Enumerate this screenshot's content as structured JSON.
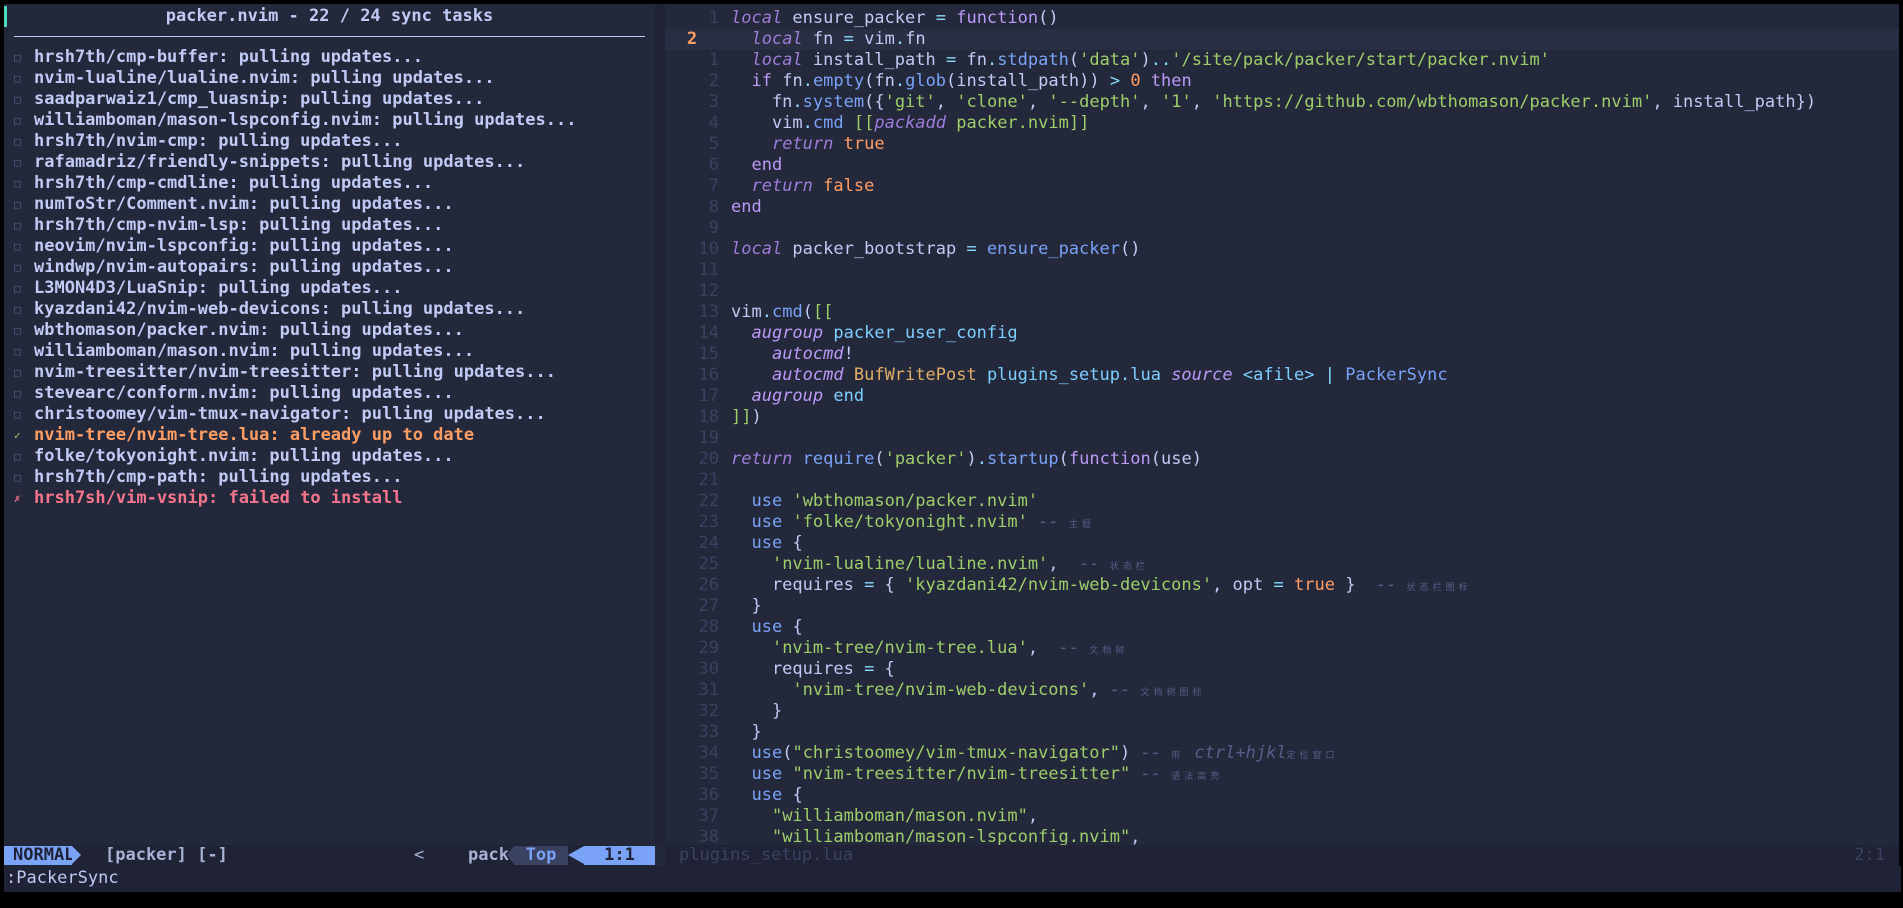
{
  "packer": {
    "title": "packer.nvim - 22 / 24 sync tasks",
    "items": [
      {
        "mark": "□",
        "text": "hrsh7th/cmp-buffer: pulling updates...",
        "state": "pending"
      },
      {
        "mark": "□",
        "text": "nvim-lualine/lualine.nvim: pulling updates...",
        "state": "pending"
      },
      {
        "mark": "□",
        "text": "saadparwaiz1/cmp_luasnip: pulling updates...",
        "state": "pending"
      },
      {
        "mark": "□",
        "text": "williamboman/mason-lspconfig.nvim: pulling updates...",
        "state": "pending"
      },
      {
        "mark": "□",
        "text": "hrsh7th/nvim-cmp: pulling updates...",
        "state": "pending"
      },
      {
        "mark": "□",
        "text": "rafamadriz/friendly-snippets: pulling updates...",
        "state": "pending"
      },
      {
        "mark": "□",
        "text": "hrsh7th/cmp-cmdline: pulling updates...",
        "state": "pending"
      },
      {
        "mark": "□",
        "text": "numToStr/Comment.nvim: pulling updates...",
        "state": "pending"
      },
      {
        "mark": "□",
        "text": "hrsh7th/cmp-nvim-lsp: pulling updates...",
        "state": "pending"
      },
      {
        "mark": "□",
        "text": "neovim/nvim-lspconfig: pulling updates...",
        "state": "pending"
      },
      {
        "mark": "□",
        "text": "windwp/nvim-autopairs: pulling updates...",
        "state": "pending"
      },
      {
        "mark": "□",
        "text": "L3MON4D3/LuaSnip: pulling updates...",
        "state": "pending"
      },
      {
        "mark": "□",
        "text": "kyazdani42/nvim-web-devicons: pulling updates...",
        "state": "pending"
      },
      {
        "mark": "□",
        "text": "wbthomason/packer.nvim: pulling updates...",
        "state": "pending"
      },
      {
        "mark": "□",
        "text": "williamboman/mason.nvim: pulling updates...",
        "state": "pending"
      },
      {
        "mark": "□",
        "text": "nvim-treesitter/nvim-treesitter: pulling updates...",
        "state": "pending"
      },
      {
        "mark": "□",
        "text": "stevearc/conform.nvim: pulling updates...",
        "state": "pending"
      },
      {
        "mark": "□",
        "text": "christoomey/vim-tmux-navigator: pulling updates...",
        "state": "pending"
      },
      {
        "mark": "✓",
        "text": "nvim-tree/nvim-tree.lua: already up to date",
        "state": "ok"
      },
      {
        "mark": "□",
        "text": "folke/tokyonight.nvim: pulling updates...",
        "state": "pending"
      },
      {
        "mark": "□",
        "text": "hrsh7th/cmp-path: pulling updates...",
        "state": "pending"
      },
      {
        "mark": "✗",
        "text": "hrsh7sh/vim-vsnip: failed to install",
        "state": "err"
      }
    ]
  },
  "editor": {
    "line_numbers": [
      "1",
      "2",
      "1",
      "2",
      "3",
      "4",
      "5",
      "6",
      "7",
      "8",
      "9",
      "10",
      "11",
      "12",
      "13",
      "14",
      "15",
      "16",
      "17",
      "18",
      "19",
      "20",
      "21",
      "22",
      "23",
      "24",
      "25",
      "26",
      "27",
      "28",
      "29",
      "30",
      "31",
      "32",
      "33",
      "34",
      "35",
      "36",
      "37",
      "38"
    ],
    "current_line_index": 1,
    "lines": [
      [
        [
          "k",
          "local"
        ],
        [
          "p",
          " ensure_packer "
        ],
        [
          "op",
          "="
        ],
        [
          "p",
          " "
        ],
        [
          "kw",
          "function"
        ],
        [
          "p",
          "()"
        ]
      ],
      [
        [
          "p",
          "  "
        ],
        [
          "k",
          "local"
        ],
        [
          "p",
          " fn "
        ],
        [
          "op",
          "="
        ],
        [
          "p",
          " vim"
        ],
        [
          "op",
          "."
        ],
        [
          "p",
          "fn"
        ]
      ],
      [
        [
          "p",
          "  "
        ],
        [
          "k",
          "local"
        ],
        [
          "p",
          " install_path "
        ],
        [
          "op",
          "="
        ],
        [
          "p",
          " fn"
        ],
        [
          "op",
          "."
        ],
        [
          "f",
          "stdpath"
        ],
        [
          "p",
          "("
        ],
        [
          "s",
          "'data'"
        ],
        [
          "p",
          ")"
        ],
        [
          "op",
          ".."
        ],
        [
          "s",
          "'/site/pack/packer/start/packer.nvim'"
        ]
      ],
      [
        [
          "p",
          "  "
        ],
        [
          "kw",
          "if"
        ],
        [
          "p",
          " fn"
        ],
        [
          "op",
          "."
        ],
        [
          "f",
          "empty"
        ],
        [
          "p",
          "(fn"
        ],
        [
          "op",
          "."
        ],
        [
          "f",
          "glob"
        ],
        [
          "p",
          "(install_path)) "
        ],
        [
          "op",
          ">"
        ],
        [
          "p",
          " "
        ],
        [
          "n",
          "0"
        ],
        [
          "p",
          " "
        ],
        [
          "kw",
          "then"
        ]
      ],
      [
        [
          "p",
          "    fn"
        ],
        [
          "op",
          "."
        ],
        [
          "f",
          "system"
        ],
        [
          "p",
          "({"
        ],
        [
          "s",
          "'git'"
        ],
        [
          "p",
          ", "
        ],
        [
          "s",
          "'clone'"
        ],
        [
          "p",
          ", "
        ],
        [
          "s",
          "'--depth'"
        ],
        [
          "p",
          ", "
        ],
        [
          "s",
          "'1'"
        ],
        [
          "p",
          ", "
        ],
        [
          "s",
          "'https://github.com/wbthomason/packer.nvim'"
        ],
        [
          "p",
          ", install_path})"
        ]
      ],
      [
        [
          "p",
          "    vim"
        ],
        [
          "op",
          "."
        ],
        [
          "f",
          "cmd"
        ],
        [
          "p",
          " "
        ],
        [
          "s",
          "[["
        ],
        [
          "k",
          "packadd"
        ],
        [
          "s",
          " packer.nvim]]"
        ]
      ],
      [
        [
          "p",
          "    "
        ],
        [
          "k",
          "return"
        ],
        [
          "p",
          " "
        ],
        [
          "n",
          "true"
        ]
      ],
      [
        [
          "p",
          "  "
        ],
        [
          "kw",
          "end"
        ]
      ],
      [
        [
          "p",
          "  "
        ],
        [
          "k",
          "return"
        ],
        [
          "p",
          " "
        ],
        [
          "n",
          "false"
        ]
      ],
      [
        [
          "kw",
          "end"
        ]
      ],
      [
        [
          "p",
          ""
        ]
      ],
      [
        [
          "k",
          "local"
        ],
        [
          "p",
          " packer_bootstrap "
        ],
        [
          "op",
          "="
        ],
        [
          "p",
          " "
        ],
        [
          "f",
          "ensure_packer"
        ],
        [
          "p",
          "()"
        ]
      ],
      [
        [
          "p",
          ""
        ]
      ],
      [
        [
          "p",
          ""
        ]
      ],
      [
        [
          "p",
          "vim"
        ],
        [
          "op",
          "."
        ],
        [
          "f",
          "cmd"
        ],
        [
          "p",
          "("
        ],
        [
          "s",
          "[["
        ]
      ],
      [
        [
          "p",
          "  "
        ],
        [
          "ka",
          "augroup"
        ],
        [
          "p",
          " "
        ],
        [
          "b",
          "packer_user_config"
        ]
      ],
      [
        [
          "p",
          "    "
        ],
        [
          "ka",
          "autocmd"
        ],
        [
          "p",
          "!"
        ]
      ],
      [
        [
          "p",
          "    "
        ],
        [
          "ka",
          "autocmd"
        ],
        [
          "p",
          " "
        ],
        [
          "y",
          "BufWritePost"
        ],
        [
          "p",
          " "
        ],
        [
          "b",
          "plugins_setup.lua"
        ],
        [
          "p",
          " "
        ],
        [
          "ka",
          "source"
        ],
        [
          "p",
          " "
        ],
        [
          "b",
          "<afile>"
        ],
        [
          "p",
          " "
        ],
        [
          "op",
          "|"
        ],
        [
          "p",
          " "
        ],
        [
          "f",
          "PackerSync"
        ]
      ],
      [
        [
          "p",
          "  "
        ],
        [
          "ka",
          "augroup"
        ],
        [
          "p",
          " "
        ],
        [
          "b",
          "end"
        ]
      ],
      [
        [
          "s",
          "]]"
        ],
        [
          "p",
          ")"
        ]
      ],
      [
        [
          "p",
          ""
        ]
      ],
      [
        [
          "k",
          "return"
        ],
        [
          "p",
          " "
        ],
        [
          "f",
          "require"
        ],
        [
          "p",
          "("
        ],
        [
          "s",
          "'packer'"
        ],
        [
          "p",
          ")"
        ],
        [
          "op",
          "."
        ],
        [
          "f",
          "startup"
        ],
        [
          "p",
          "("
        ],
        [
          "kw",
          "function"
        ],
        [
          "p",
          "(use)"
        ]
      ],
      [
        [
          "p",
          ""
        ]
      ],
      [
        [
          "p",
          "  "
        ],
        [
          "f",
          "use"
        ],
        [
          "p",
          " "
        ],
        [
          "s",
          "'wbthomason/packer.nvim'"
        ]
      ],
      [
        [
          "p",
          "  "
        ],
        [
          "f",
          "use"
        ],
        [
          "p",
          " "
        ],
        [
          "s",
          "'folke/tokyonight.nvim'"
        ],
        [
          "p",
          " "
        ],
        [
          "c",
          "-- "
        ],
        [
          "cs",
          "主题"
        ]
      ],
      [
        [
          "p",
          "  "
        ],
        [
          "f",
          "use"
        ],
        [
          "p",
          " {"
        ]
      ],
      [
        [
          "p",
          "    "
        ],
        [
          "s",
          "'nvim-lualine/lualine.nvim'"
        ],
        [
          "p",
          ",  "
        ],
        [
          "c",
          "-- "
        ],
        [
          "cs",
          "状态栏"
        ]
      ],
      [
        [
          "p",
          "    requires "
        ],
        [
          "op",
          "="
        ],
        [
          "p",
          " { "
        ],
        [
          "s",
          "'kyazdani42/nvim-web-devicons'"
        ],
        [
          "p",
          ", opt "
        ],
        [
          "op",
          "="
        ],
        [
          "p",
          " "
        ],
        [
          "n",
          "true"
        ],
        [
          "p",
          " }  "
        ],
        [
          "c",
          "-- "
        ],
        [
          "cs",
          "状态栏图标"
        ]
      ],
      [
        [
          "p",
          "  }"
        ]
      ],
      [
        [
          "p",
          "  "
        ],
        [
          "f",
          "use"
        ],
        [
          "p",
          " {"
        ]
      ],
      [
        [
          "p",
          "    "
        ],
        [
          "s",
          "'nvim-tree/nvim-tree.lua'"
        ],
        [
          "p",
          ",  "
        ],
        [
          "c",
          "-- "
        ],
        [
          "cs",
          "文档树"
        ]
      ],
      [
        [
          "p",
          "    requires "
        ],
        [
          "op",
          "="
        ],
        [
          "p",
          " {"
        ]
      ],
      [
        [
          "p",
          "      "
        ],
        [
          "s",
          "'nvim-tree/nvim-web-devicons'"
        ],
        [
          "p",
          ", "
        ],
        [
          "c",
          "-- "
        ],
        [
          "cs",
          "文档树图标"
        ]
      ],
      [
        [
          "p",
          "    }"
        ]
      ],
      [
        [
          "p",
          "  }"
        ]
      ],
      [
        [
          "p",
          "  "
        ],
        [
          "f",
          "use"
        ],
        [
          "p",
          "("
        ],
        [
          "s",
          "\"christoomey/vim-tmux-navigator\""
        ],
        [
          "p",
          ") "
        ],
        [
          "c",
          "-- "
        ],
        [
          "cs",
          "用"
        ],
        [
          "c",
          " ctrl+hjkl"
        ],
        [
          "cs",
          "定位窗口"
        ]
      ],
      [
        [
          "p",
          "  "
        ],
        [
          "f",
          "use"
        ],
        [
          "p",
          " "
        ],
        [
          "s",
          "\"nvim-treesitter/nvim-treesitter\""
        ],
        [
          "p",
          " "
        ],
        [
          "c",
          "-- "
        ],
        [
          "cs",
          "语法高亮"
        ]
      ],
      [
        [
          "p",
          "  "
        ],
        [
          "f",
          "use"
        ],
        [
          "p",
          " {"
        ]
      ],
      [
        [
          "p",
          "    "
        ],
        [
          "s",
          "\"williamboman/mason.nvim\""
        ],
        [
          "p",
          ","
        ]
      ],
      [
        [
          "p",
          "    "
        ],
        [
          "s",
          "\"williamboman/mason-lspconfig.nvim\""
        ],
        [
          "p",
          ","
        ]
      ]
    ]
  },
  "statusline": {
    "mode": "NORMAL",
    "buffer": "[packer] [-]",
    "chevron": "<",
    "filetype": "packer",
    "percent": "Top",
    "position": "1:1",
    "right_file": "plugins_setup.lua",
    "right_pos": "2:1"
  },
  "cmdline": ":PackerSync",
  "colors": {
    "background": "#24283b",
    "accent": "#7aa2f7",
    "ok": "#ff9e64",
    "error": "#f7768e"
  }
}
